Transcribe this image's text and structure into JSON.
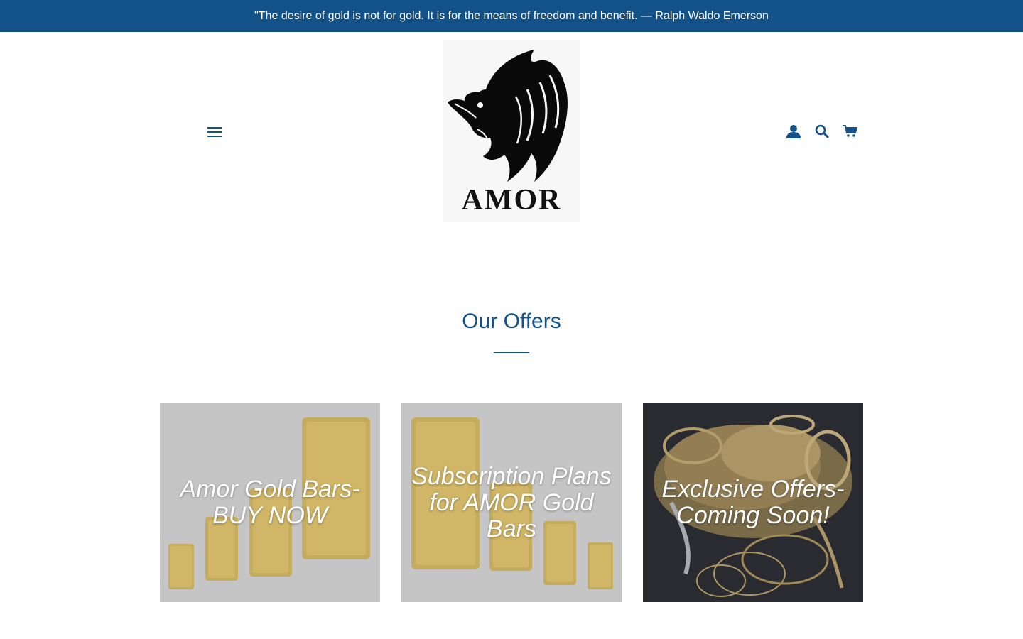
{
  "announcement": {
    "text": "\"The desire of gold is not for gold. It is for the means of freedom and benefit. — Ralph Waldo Emerson"
  },
  "header": {
    "menu_icon": "hamburger-menu-icon",
    "logo": {
      "brand_text": "AMOR",
      "icon": "lion-head-logo"
    },
    "icons": [
      "account-icon",
      "search-icon",
      "cart-icon"
    ]
  },
  "offers": {
    "title": "Our Offers",
    "cards": [
      {
        "label": "Amor Gold Bars- BUY NOW",
        "image": "gold-bars"
      },
      {
        "label": "Subscription Plans for AMOR Gold Bars",
        "image": "gold-bars"
      },
      {
        "label": "Exclusive Offers- Coming Soon!",
        "image": "gold-jewelry"
      }
    ]
  },
  "colors": {
    "brand_blue": "#135289",
    "gold": "#d9a520",
    "overlay_grey": "#bdbdbd"
  }
}
